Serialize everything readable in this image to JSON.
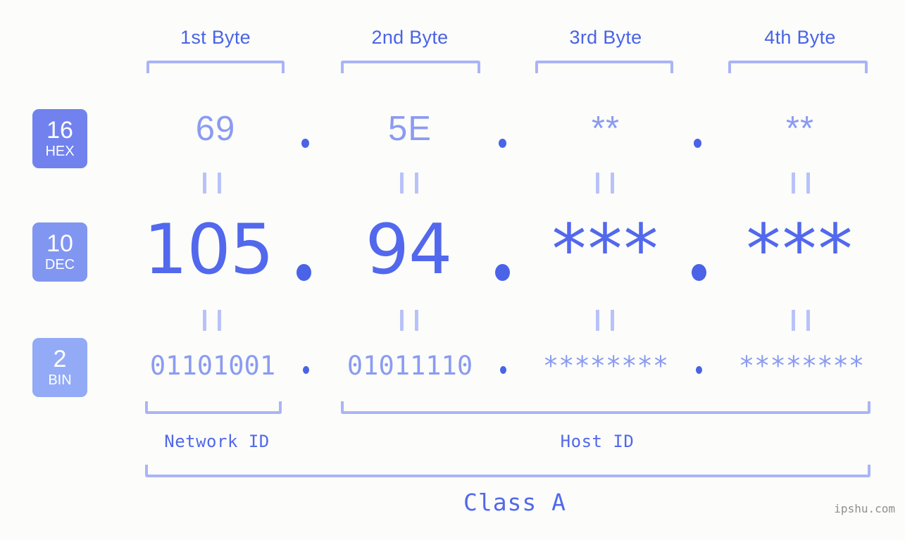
{
  "watermark": "ipshu.com",
  "colors": {
    "background": "#fcfdfa",
    "accent_strong": "#4a63e7",
    "accent_mid": "#5268ed",
    "accent_light": "#8b9bf2",
    "bracket": "#aab4f7",
    "badge_hex": "#7182ee",
    "badge_dec": "#8196f0",
    "badge_bin": "#93aaf6"
  },
  "headers": [
    {
      "label": "1st Byte"
    },
    {
      "label": "2nd Byte"
    },
    {
      "label": "3rd Byte"
    },
    {
      "label": "4th Byte"
    }
  ],
  "bases": [
    {
      "num": "16",
      "abbr": "HEX"
    },
    {
      "num": "10",
      "abbr": "DEC"
    },
    {
      "num": "2",
      "abbr": "BIN"
    }
  ],
  "rows": {
    "hex": {
      "base_num": "16",
      "base_abbr": "HEX",
      "values": [
        "69",
        "5E",
        "**",
        "**"
      ],
      "separator": "."
    },
    "dec": {
      "base_num": "10",
      "base_abbr": "DEC",
      "values": [
        "105",
        "94",
        "***",
        "***"
      ],
      "separator": "."
    },
    "bin": {
      "base_num": "2",
      "base_abbr": "BIN",
      "values": [
        "01101001",
        "01011110",
        "********",
        "********"
      ],
      "separator": "."
    }
  },
  "ids": {
    "network": "Network ID",
    "host": "Host ID"
  },
  "class": {
    "label": "Class A"
  }
}
